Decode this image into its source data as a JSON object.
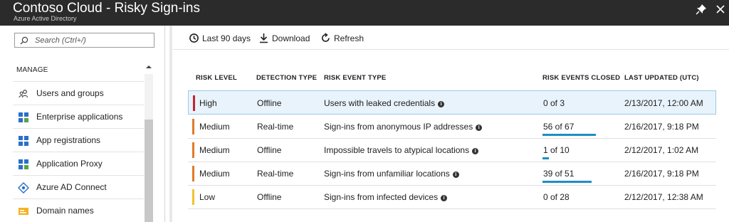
{
  "window": {
    "title": "Contoso Cloud - Risky Sign-ins",
    "subtitle": "Azure Active Directory"
  },
  "sidebar": {
    "search_placeholder": "Search (Ctrl+/)",
    "section_header": "MANAGE",
    "items": [
      {
        "label": "Users and groups",
        "icon": "users-icon"
      },
      {
        "label": "Enterprise applications",
        "icon": "enterprise-apps-icon"
      },
      {
        "label": "App registrations",
        "icon": "app-registrations-icon"
      },
      {
        "label": "Application Proxy",
        "icon": "application-proxy-icon"
      },
      {
        "label": "Azure AD Connect",
        "icon": "azure-ad-connect-icon"
      },
      {
        "label": "Domain names",
        "icon": "domain-names-icon"
      }
    ]
  },
  "toolbar": {
    "range_label": "Last 90 days",
    "download_label": "Download",
    "refresh_label": "Refresh"
  },
  "table": {
    "headers": [
      "RISK LEVEL",
      "DETECTION TYPE",
      "RISK EVENT TYPE",
      "RISK EVENTS CLOSED",
      "LAST UPDATED (UTC)"
    ],
    "rows": [
      {
        "risk_level": "High",
        "detection": "Offline",
        "event_type": "Users with leaked credentials",
        "closed": "0 of 3",
        "closed_fraction": 0.0,
        "updated": "2/13/2017, 12:00 AM",
        "severity_color": "#c4262e"
      },
      {
        "risk_level": "Medium",
        "detection": "Real-time",
        "event_type": "Sign-ins from anonymous IP addresses",
        "closed": "56 of 67",
        "closed_fraction": 0.836,
        "updated": "2/16/2017, 9:18 PM",
        "severity_color": "#e07a2a"
      },
      {
        "risk_level": "Medium",
        "detection": "Offline",
        "event_type": "Impossible travels to atypical locations",
        "closed": "1 of 10",
        "closed_fraction": 0.1,
        "updated": "2/12/2017, 1:02 AM",
        "severity_color": "#e07a2a"
      },
      {
        "risk_level": "Medium",
        "detection": "Real-time",
        "event_type": "Sign-ins from unfamiliar locations",
        "closed": "39 of 51",
        "closed_fraction": 0.765,
        "updated": "2/16/2017, 9:18 PM",
        "severity_color": "#e07a2a"
      },
      {
        "risk_level": "Low",
        "detection": "Offline",
        "event_type": "Sign-ins from infected devices",
        "closed": "0 of 28",
        "closed_fraction": 0.0,
        "updated": "2/12/2017, 12:38 AM",
        "severity_color": "#f2c230"
      }
    ]
  },
  "colors": {
    "titlebar": "#2b2b2b",
    "progress": "#1d8fc2",
    "selected_row": "#e8f3fb"
  }
}
